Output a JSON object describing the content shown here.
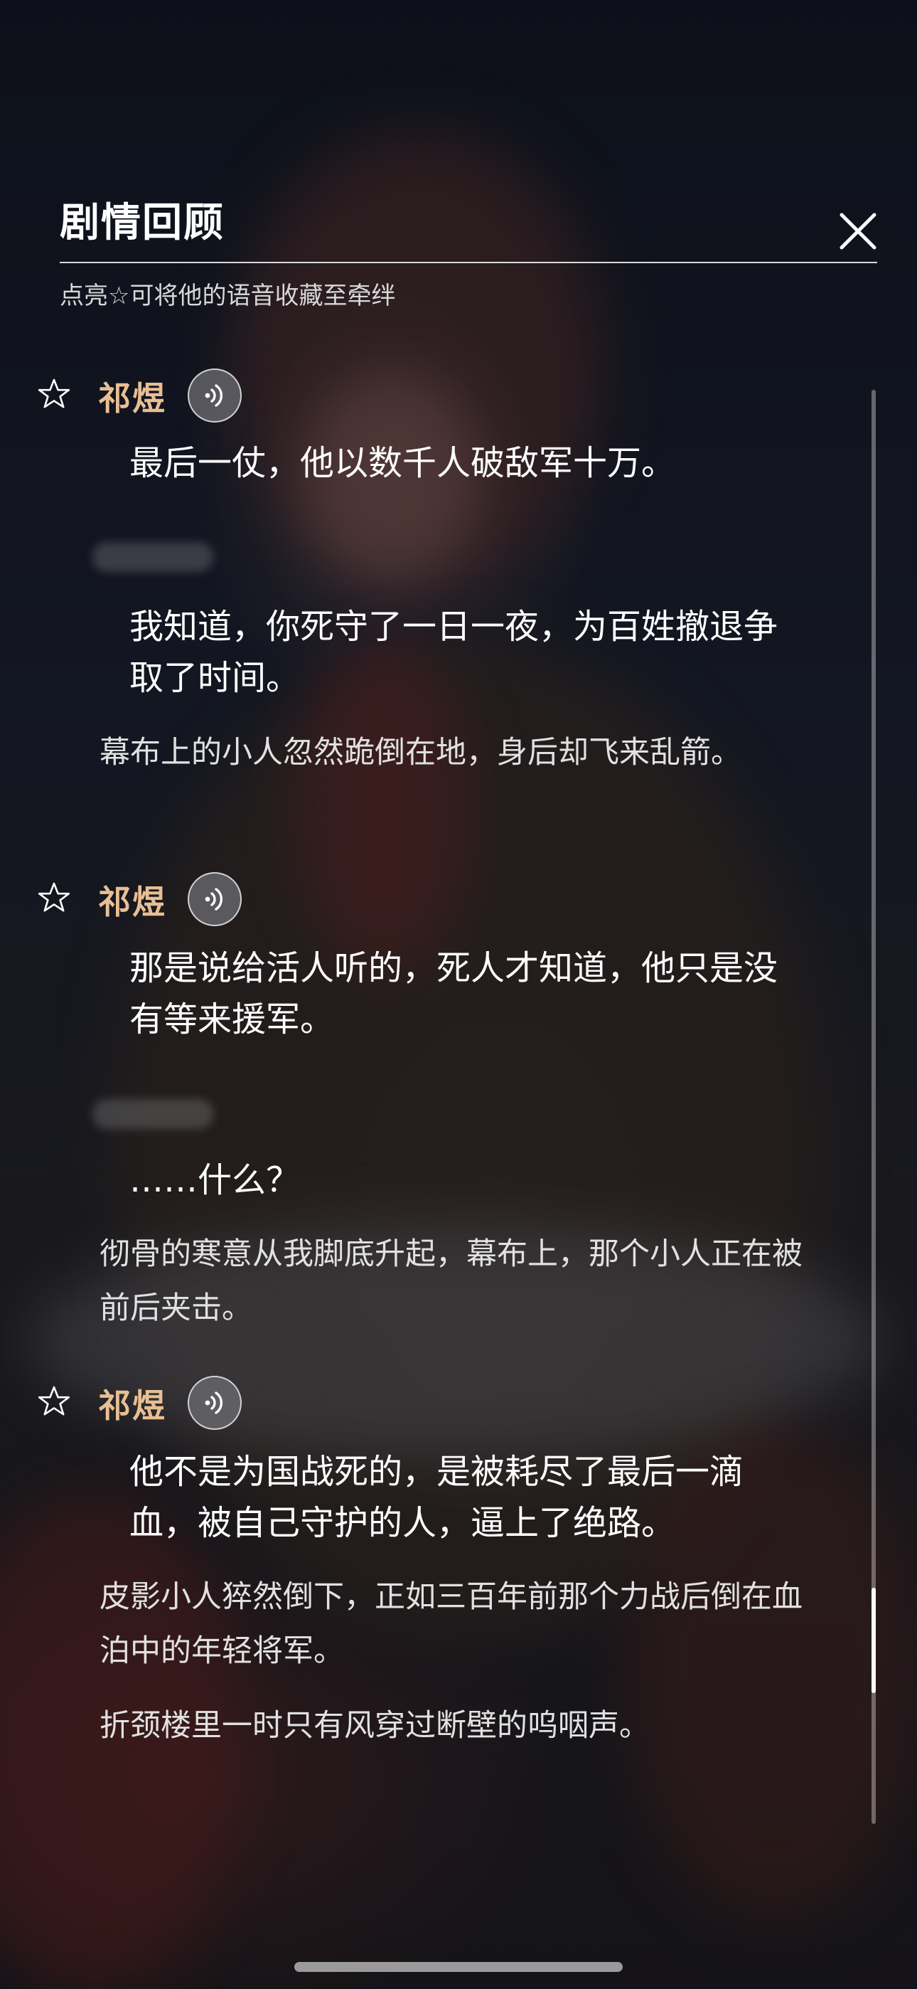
{
  "header": {
    "title": "剧情回顾",
    "hint": "点亮☆可将他的语音收藏至牵绊"
  },
  "entries": [
    {
      "speaker": "祁煜",
      "line": "最后一仗，他以数千人破敌军十万。"
    },
    {
      "line": "我知道，你死守了一日一夜，为百姓撤退争取了时间。"
    },
    {
      "narration": "幕布上的小人忽然跪倒在地，身后却飞来乱箭。"
    },
    {
      "speaker": "祁煜",
      "line": "那是说给活人听的，死人才知道，他只是没有等来援军。"
    },
    {
      "line": "……什么？"
    },
    {
      "narration": "彻骨的寒意从我脚底升起，幕布上，那个小人正在被前后夹击。"
    },
    {
      "speaker": "祁煜",
      "line": "他不是为国战死的，是被耗尽了最后一滴血，被自己守护的人，逼上了绝路。"
    },
    {
      "narration": "皮影小人猝然倒下，正如三百年前那个力战后倒在血泊中的年轻将军。"
    },
    {
      "narration": "折颈楼里一时只有风穿过断壁的呜咽声。"
    }
  ],
  "icons": {
    "close": "close-icon",
    "star": "star-outline-icon",
    "voice": "voice-play-icon"
  },
  "colors": {
    "speaker": "#e8bf94",
    "dialogue": "#ffffff",
    "narration": "#e1e1e1"
  }
}
